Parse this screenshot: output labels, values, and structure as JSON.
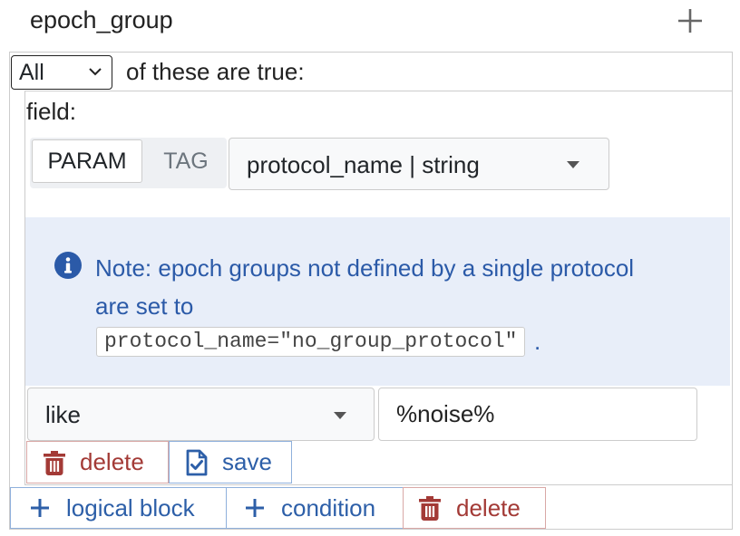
{
  "group": {
    "title": "epoch_group",
    "add_icon": "plus-icon"
  },
  "condition_block": {
    "quantifier": "All",
    "quantifier_suffix": "of these are true:"
  },
  "field": {
    "label": "field:",
    "segments": [
      "PARAM",
      "TAG"
    ],
    "selected_segment": "PARAM",
    "selected_field": "protocol_name | string"
  },
  "note": {
    "icon": "info-icon",
    "text": "Note: epoch groups not defined by a single protocol are set to",
    "code": "protocol_name=\"no_group_protocol\"",
    "trailing": "."
  },
  "operator": {
    "selected": "like"
  },
  "value": {
    "current": "%noise%"
  },
  "condition_actions": {
    "delete_label": "delete",
    "save_label": "save"
  },
  "block_actions": {
    "logical_block_label": "logical block",
    "condition_label": "condition",
    "delete_label": "delete"
  },
  "colors": {
    "danger": "#a33a36",
    "primary": "#2d5fa8",
    "note_bg": "#e8eef9"
  }
}
